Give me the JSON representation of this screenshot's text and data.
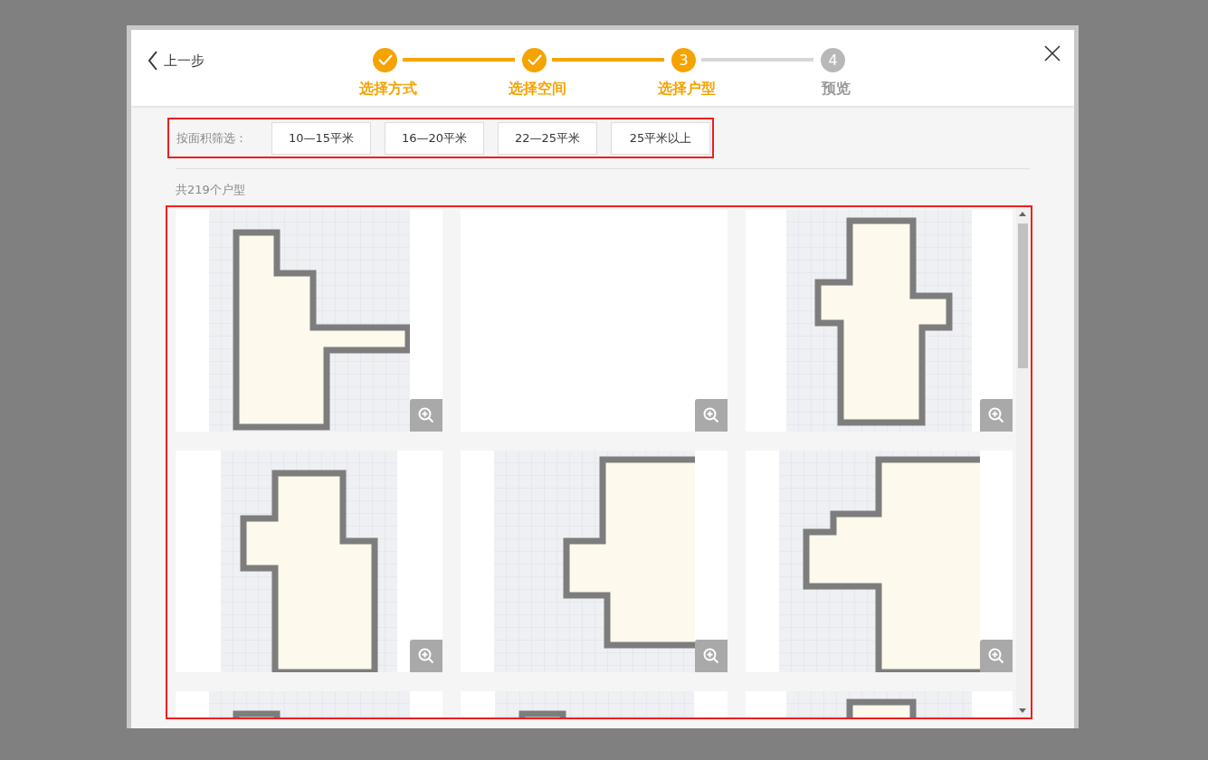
{
  "back": {
    "label": "上一步"
  },
  "steps": [
    {
      "label": "选择方式",
      "done": true,
      "reached": true
    },
    {
      "label": "选择空间",
      "done": true,
      "reached": true
    },
    {
      "label": "选择户型",
      "done": false,
      "reached": true,
      "number": "3"
    },
    {
      "label": "预览",
      "done": false,
      "reached": false,
      "number": "4"
    }
  ],
  "filter": {
    "label": "按面积筛选：",
    "options": [
      "10—15平米",
      "16—20平米",
      "22—25平米",
      "25平米以上"
    ]
  },
  "count": "共219个户型",
  "cards": [
    {
      "kind": "plan"
    },
    {
      "kind": "blank"
    },
    {
      "kind": "plan"
    },
    {
      "kind": "plan"
    },
    {
      "kind": "plan"
    },
    {
      "kind": "plan"
    },
    {
      "kind": "plan"
    },
    {
      "kind": "plan"
    },
    {
      "kind": "plan"
    }
  ]
}
